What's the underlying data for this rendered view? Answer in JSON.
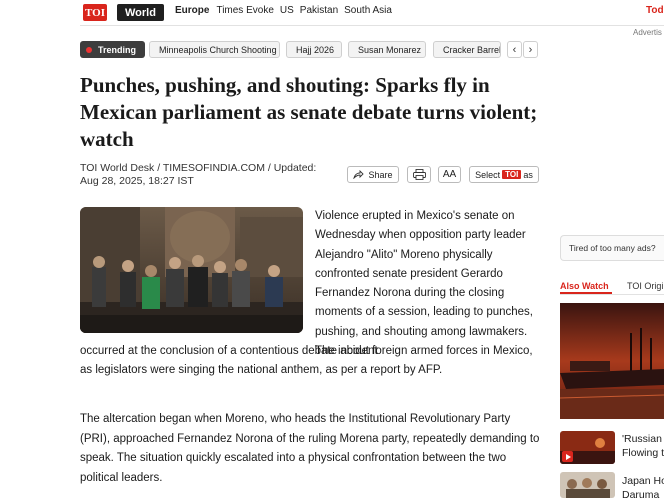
{
  "nav": {
    "logo": "TOI",
    "section": "World",
    "links": [
      "Europe",
      "Times Evoke",
      "US",
      "Pakistan",
      "South Asia"
    ],
    "right_link": "Tod",
    "ad_label": "Advertis"
  },
  "trending": {
    "label": "Trending",
    "chips": [
      "Minneapolis Church Shooting",
      "Hajj 2026",
      "Susan Monarez",
      "Cracker Barrel"
    ]
  },
  "article": {
    "headline": "Punches, pushing, and shouting: Sparks fly in Mexican parliament as senate debate turns violent; watch",
    "byline_author": "TOI World Desk / TIMESOFINDIA.COM / Updated:",
    "byline_date": "Aug 28, 2025, 18:27 IST",
    "share_label": "Share",
    "font_label": "AA",
    "select_prefix": "Select",
    "select_badge": "TOI",
    "select_suffix": "as",
    "para1_wrap": "Violence erupted in Mexico's senate on Wednesday when opposition party leader Alejandro \"Alito\" Moreno physically confronted senate president Gerardo Fernandez Norona during the closing moments of a session, leading to punches, pushing, and shouting among lawmakers. The incident",
    "para1_full": "occurred at the conclusion of a contentious debate about foreign armed forces in Mexico, as legislators were singing the national anthem, as per a report by AFP.",
    "para2": "The altercation began when Moreno, who heads the Institutional Revolutionary Party (PRI), approached Fernandez Norona of the ruling Morena party, repeatedly demanding to speak. The situation quickly escalated into a physical confrontation between the two political leaders."
  },
  "sidebar": {
    "ad_text": "Tired of too many ads?",
    "tab_active": "Also Watch",
    "tab_other": "TOI Origi",
    "items": [
      {
        "title1": "'Russian",
        "title2": "Flowing t"
      },
      {
        "title1": "Japan Ho",
        "title2": "Daruma"
      }
    ]
  },
  "colors": {
    "brand_red": "#d9251c",
    "dark": "#1f1f1f"
  }
}
